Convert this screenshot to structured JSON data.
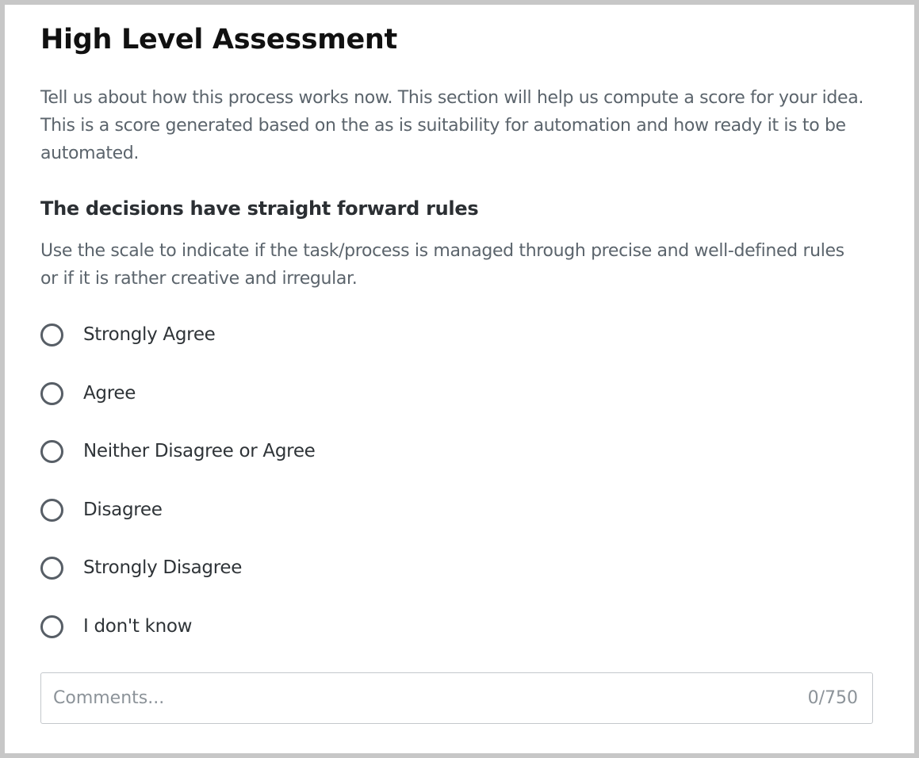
{
  "form": {
    "title": "High Level Assessment",
    "intro": "Tell us about how this process works now. This section will help us compute a score for your idea. This is a score generated based on the as is suitability for automation and how ready it is to be automated."
  },
  "question": {
    "title": "The decisions have straight forward rules",
    "description": "Use the scale to indicate if the task/process is managed through precise and well-defined rules or if it is rather creative and irregular.",
    "options": [
      {
        "label": "Strongly Agree",
        "selected": false
      },
      {
        "label": "Agree",
        "selected": false
      },
      {
        "label": "Neither Disagree or Agree",
        "selected": false
      },
      {
        "label": "Disagree",
        "selected": false
      },
      {
        "label": "Strongly Disagree",
        "selected": false
      },
      {
        "label": "I don't know",
        "selected": false
      }
    ]
  },
  "comments": {
    "placeholder": "Comments...",
    "value": "",
    "counter": "0/750"
  }
}
